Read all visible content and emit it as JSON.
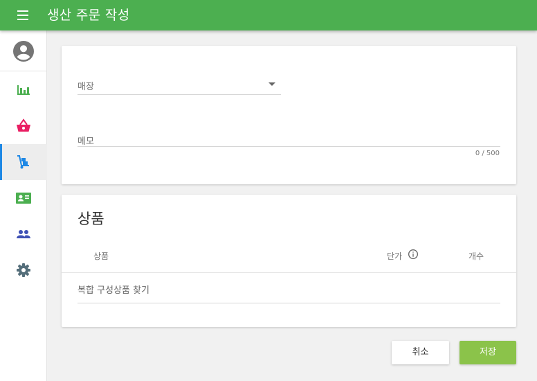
{
  "header": {
    "title": "생산 주문 작성",
    "menu_icon": "menu-icon",
    "background_color": "#4caf50"
  },
  "sidebar": {
    "avatar_icon": "account-circle-icon",
    "active_color": "#1e88e5",
    "items": [
      {
        "name": "chart",
        "icon": "bar-chart-icon",
        "color": "#4caf50",
        "active": false
      },
      {
        "name": "basket",
        "icon": "shopping-basket-icon",
        "color": "#e91e63",
        "active": false
      },
      {
        "name": "production",
        "icon": "hand-truck-icon",
        "color": "#1e88e5",
        "active": true
      },
      {
        "name": "contact",
        "icon": "contact-card-icon",
        "color": "#4caf50",
        "active": false
      },
      {
        "name": "people",
        "icon": "people-icon",
        "color": "#3f51b5",
        "active": false
      },
      {
        "name": "settings",
        "icon": "gear-icon",
        "color": "#546e7a",
        "active": false
      }
    ]
  },
  "form": {
    "store_label": "매장",
    "memo_label": "메모",
    "memo_counter": "0 / 500"
  },
  "products": {
    "section_title": "상품",
    "columns": {
      "product": "상품",
      "price": "단가",
      "count": "개수"
    },
    "search_placeholder": "복합 구성상품 찾기"
  },
  "actions": {
    "cancel_label": "취소",
    "save_label": "저장",
    "save_color": "#8bc34a"
  }
}
